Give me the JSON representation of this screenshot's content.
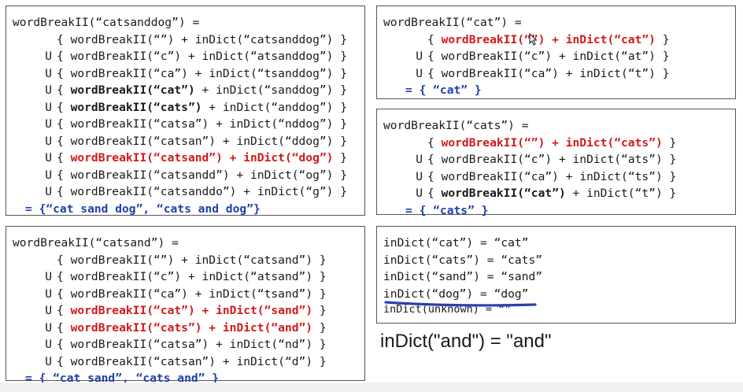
{
  "panels": {
    "catsanddog": {
      "header": "wordBreakII(“catsanddog”) =",
      "terms": [
        {
          "u": "",
          "left": "wordBreakII(“”)",
          "right": "inDict(“catsanddog”)",
          "style": "plain"
        },
        {
          "u": "U",
          "left": "wordBreakII(“c”)",
          "right": "inDict(“atsanddog”)",
          "style": "plain"
        },
        {
          "u": "U",
          "left": "wordBreakII(“ca”)",
          "right": "inDict(“tsanddog”)",
          "style": "plain"
        },
        {
          "u": "U",
          "left": "wordBreakII(“cat”)",
          "right": "inDict(“sanddog”)",
          "style": "bold-left"
        },
        {
          "u": "U",
          "left": "wordBreakII(“cats”)",
          "right": "inDict(“anddog”)",
          "style": "bold-left"
        },
        {
          "u": "U",
          "left": "wordBreakII(“catsa”)",
          "right": "inDict(“nddog”)",
          "style": "plain"
        },
        {
          "u": "U",
          "left": "wordBreakII(“catsan”)",
          "right": "inDict(“ddog”)",
          "style": "plain"
        },
        {
          "u": "U",
          "left": "wordBreakII(“catsand”)",
          "right": "inDict(“dog”)",
          "style": "red"
        },
        {
          "u": "U",
          "left": "wordBreakII(“catsandd”)",
          "right": "inDict(“og”)",
          "style": "plain"
        },
        {
          "u": "U",
          "left": "wordBreakII(“catsanddo”)",
          "right": "inDict(“g”)",
          "style": "plain"
        }
      ],
      "result": "= {“cat sand dog”, “cats and dog”}"
    },
    "catsand": {
      "header": "wordBreakII(“catsand”) =",
      "terms": [
        {
          "u": "",
          "left": "wordBreakII(“”)",
          "right": "inDict(“catsand”)",
          "style": "plain"
        },
        {
          "u": "U",
          "left": "wordBreakII(“c”)",
          "right": "inDict(“atsand”)",
          "style": "plain"
        },
        {
          "u": "U",
          "left": "wordBreakII(“ca”)",
          "right": "inDict(“tsand”)",
          "style": "plain"
        },
        {
          "u": "U",
          "left": "wordBreakII(“cat”)",
          "right": "inDict(“sand”)",
          "style": "red"
        },
        {
          "u": "U",
          "left": "wordBreakII(“cats”)",
          "right": "inDict(“and”)",
          "style": "red"
        },
        {
          "u": "U",
          "left": "wordBreakII(“catsa”)",
          "right": "inDict(“nd”)",
          "style": "plain"
        },
        {
          "u": "U",
          "left": "wordBreakII(“catsan”)",
          "right": "inDict(“d”)",
          "style": "plain"
        }
      ],
      "result": "= { “cat sand”, “cats and” }"
    },
    "cat": {
      "header": "wordBreakII(“cat”) =",
      "terms": [
        {
          "u": "",
          "left": "wordBreakII(“”)",
          "right": "inDict(“cat”)",
          "style": "red"
        },
        {
          "u": "U",
          "left": "wordBreakII(“c”)",
          "right": "inDict(“at”)",
          "style": "plain"
        },
        {
          "u": "U",
          "left": "wordBreakII(“ca”)",
          "right": "inDict(“t”)",
          "style": "plain"
        }
      ],
      "result": "= { “cat” }"
    },
    "cats": {
      "header": "wordBreakII(“cats”) =",
      "terms": [
        {
          "u": "",
          "left": "wordBreakII(“”)",
          "right": "inDict(“cats”)",
          "style": "red"
        },
        {
          "u": "U",
          "left": "wordBreakII(“c”)",
          "right": "inDict(“ats”)",
          "style": "plain"
        },
        {
          "u": "U",
          "left": "wordBreakII(“ca”)",
          "right": "inDict(“ts”)",
          "style": "plain"
        },
        {
          "u": "U",
          "left": "wordBreakII(“cat”)",
          "right": "inDict(“t”)",
          "style": "bold-left"
        }
      ],
      "result": "= { “cats” }"
    },
    "dict": {
      "lines": [
        "inDict(“cat”) = “cat”",
        "inDict(“cats”) = “cats”",
        "inDict(“sand”) = “sand”",
        "inDict(“dog”) = “dog”",
        "inDict(unknown) = “”"
      ]
    }
  },
  "note": "inDict(\"and\") = \"and\"",
  "colors": {
    "red": "#d11a1a",
    "result_blue": "#1f3fa8",
    "strike_blue": "#2a3fb0"
  }
}
